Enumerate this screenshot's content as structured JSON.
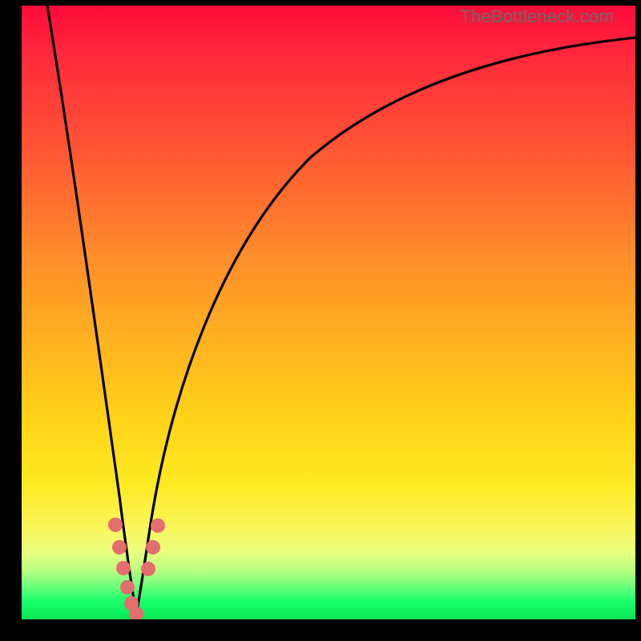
{
  "watermark": "TheBottleneck.com",
  "colors": {
    "frame": "#000000",
    "curve": "#000000",
    "marker": "#e46d6d",
    "gradient_top": "#ff0b3b",
    "gradient_bottom": "#09e257"
  },
  "chart_data": {
    "type": "line",
    "title": "",
    "xlabel": "",
    "ylabel": "",
    "xlim": [
      0,
      100
    ],
    "ylim": [
      0,
      100
    ],
    "x": [
      0,
      4,
      8,
      12,
      15,
      17,
      18.5,
      20,
      22,
      25,
      30,
      37,
      45,
      55,
      65,
      75,
      85,
      95,
      100
    ],
    "y": [
      100,
      78,
      56,
      34,
      16,
      6,
      1,
      5,
      15,
      30,
      47,
      62,
      73,
      81,
      86.5,
      90.5,
      93,
      94.5,
      95
    ],
    "minimum_x": 18.5,
    "markers": {
      "x": [
        14.8,
        15.5,
        16.3,
        17.0,
        17.8,
        18.6,
        20.5,
        21.3,
        22.0
      ],
      "y": [
        15.0,
        11.5,
        8.0,
        5.0,
        2.5,
        1.0,
        8.0,
        11.5,
        15.0
      ]
    },
    "note": "x and y are normalized 0–100 across the plot area; y=0 is the bottom (green), y=100 is the top (red). Values are visually estimated from the rendered curve."
  }
}
